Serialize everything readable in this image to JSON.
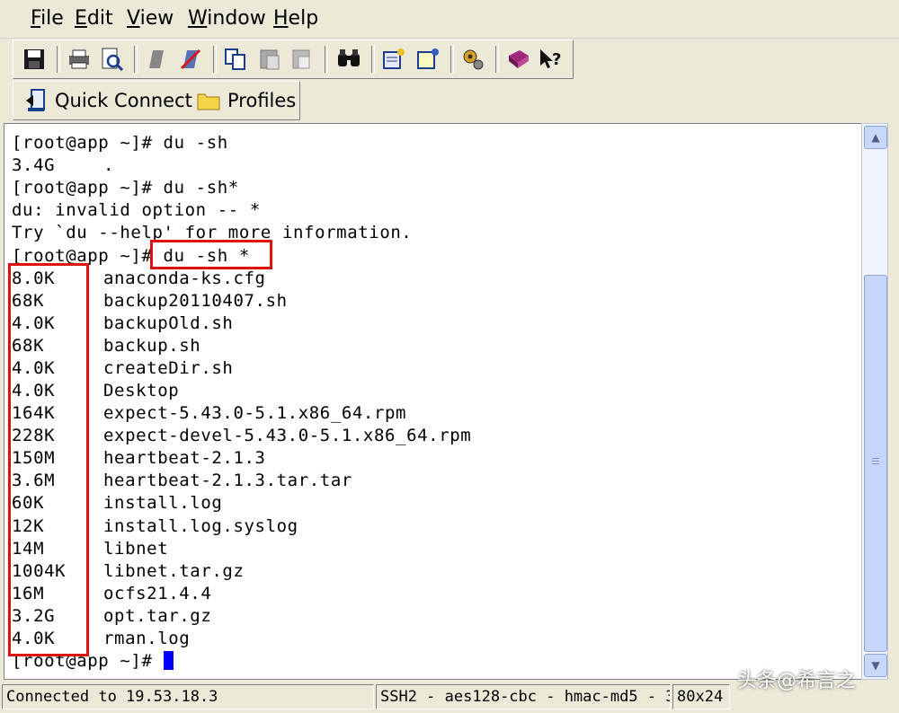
{
  "menu": [
    {
      "label": "File",
      "underline": "F",
      "rest": "ile"
    },
    {
      "label": "Edit",
      "underline": "E",
      "rest": "dit"
    },
    {
      "label": "View",
      "underline": "V",
      "rest": "iew"
    },
    {
      "label": "Window",
      "underline": "W",
      "rest": "indow"
    },
    {
      "label": "Help",
      "underline": "H",
      "rest": "elp"
    }
  ],
  "toolbar_icons": [
    "save-icon",
    "print-icon",
    "print-preview-icon",
    "connect-icon",
    "disconnect-icon",
    "copy-icon",
    "paste-icon",
    "clear-icon",
    "find-icon",
    "session-options-icon",
    "global-options-icon",
    "settings-icon",
    "keymap-icon",
    "help-icon"
  ],
  "quickbar": {
    "quick_connect": "Quick Connect",
    "profiles": "Profiles"
  },
  "terminal": {
    "lines": [
      {
        "a": "[root@app ~]# du -sh",
        "b": ""
      },
      {
        "a": "3.4G",
        "b": "."
      },
      {
        "a": "[root@app ~]# du -sh*",
        "b": ""
      },
      {
        "a": "du: invalid option -- *",
        "b": ""
      },
      {
        "a": "Try `du --help' for more information.",
        "b": ""
      },
      {
        "a": "[root@app ~]# du -sh *",
        "b": ""
      },
      {
        "a": "8.0K",
        "b": "anaconda-ks.cfg"
      },
      {
        "a": "68K",
        "b": "backup20110407.sh"
      },
      {
        "a": "4.0K",
        "b": "backupOld.sh"
      },
      {
        "a": "68K",
        "b": "backup.sh"
      },
      {
        "a": "4.0K",
        "b": "createDir.sh"
      },
      {
        "a": "4.0K",
        "b": "Desktop"
      },
      {
        "a": "164K",
        "b": "expect-5.43.0-5.1.x86_64.rpm"
      },
      {
        "a": "228K",
        "b": "expect-devel-5.43.0-5.1.x86_64.rpm"
      },
      {
        "a": "150M",
        "b": "heartbeat-2.1.3"
      },
      {
        "a": "3.6M",
        "b": "heartbeat-2.1.3.tar.tar"
      },
      {
        "a": "60K",
        "b": "install.log"
      },
      {
        "a": "12K",
        "b": "install.log.syslog"
      },
      {
        "a": "14M",
        "b": "libnet"
      },
      {
        "a": "1004K",
        "b": "libnet.tar.gz"
      },
      {
        "a": "16M",
        "b": "ocfs21.4.4"
      },
      {
        "a": "3.2G",
        "b": "opt.tar.gz"
      },
      {
        "a": "4.0K",
        "b": "rman.log"
      }
    ],
    "prompt": "[root@app ~]# ",
    "cursor_color": "#0000ff"
  },
  "status": {
    "connection": "Connected to 19.53.18.3",
    "cipher": "SSH2 - aes128-cbc - hmac-md5 - 3",
    "size": "80x24"
  },
  "watermark": "头条@希言之",
  "colors": {
    "highlight": "#e01010",
    "background": "#ece9d8"
  }
}
